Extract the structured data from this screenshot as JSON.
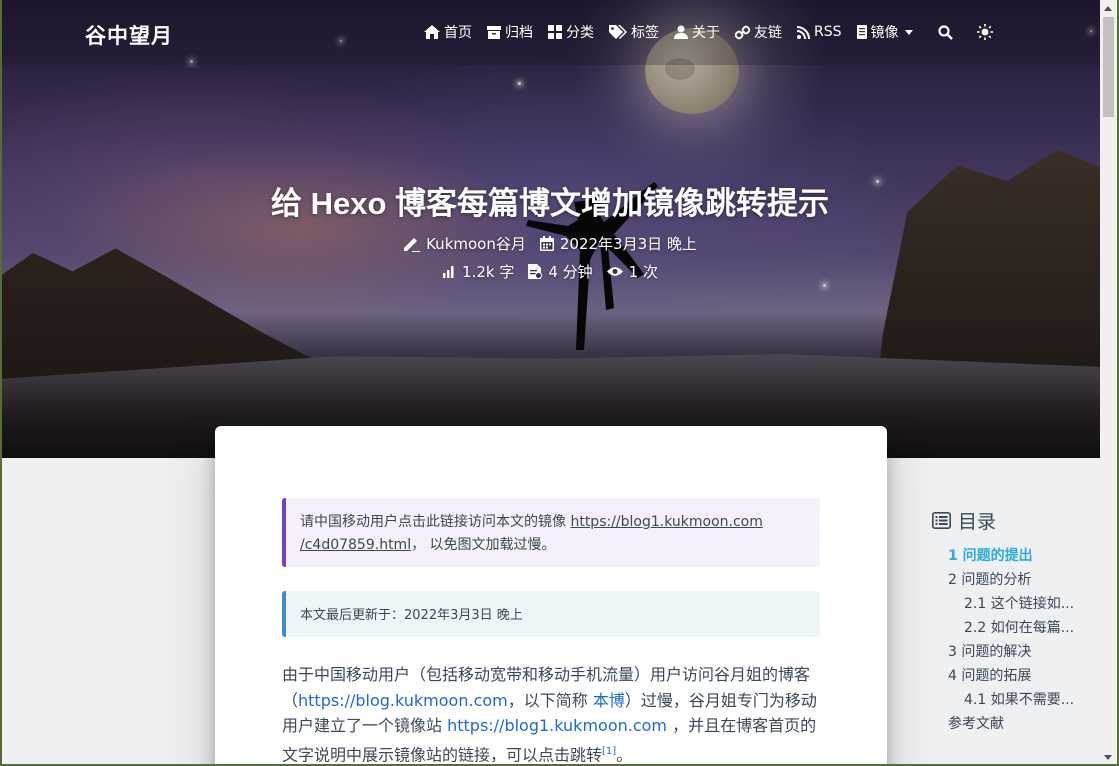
{
  "site": {
    "brand": "谷中望月"
  },
  "nav": {
    "items": [
      {
        "label": "首页",
        "icon": "home-icon"
      },
      {
        "label": "归档",
        "icon": "archive-icon"
      },
      {
        "label": "分类",
        "icon": "category-icon"
      },
      {
        "label": "标签",
        "icon": "tags-icon"
      },
      {
        "label": "关于",
        "icon": "user-icon"
      },
      {
        "label": "友链",
        "icon": "link-icon"
      },
      {
        "label": "RSS",
        "icon": "rss-icon"
      },
      {
        "label": "镜像",
        "icon": "mirror-icon",
        "dropdown": true
      }
    ],
    "search_icon": "search-icon",
    "theme_icon": "sun-icon"
  },
  "post": {
    "title": "给 Hexo 博客每篇博文增加镜像跳转提示",
    "author": "Kukmoon谷月",
    "date": "2022年3月3日 晚上",
    "words": "1.2k 字",
    "read_time": "4 分钟",
    "views": "1 次"
  },
  "content": {
    "mirror_note_prefix": "请中国移动用户点击此链接访问本文的镜像 ",
    "mirror_link_1": "https://blog1.kukmoon.com",
    "mirror_link_2": "/c4d07859.html",
    "mirror_note_suffix": "， 以免图文加载过慢。",
    "updated_note": "本文最后更新于：2022年3月3日 晚上",
    "para_1": "由于中国移动用户（包括移动宽带和移动手机流量）用户访问谷月姐的博客（",
    "para_link_blog": "https://blog.kukmoon.com",
    "para_2": "，以下简称 ",
    "para_link_self": "本博",
    "para_3": "）过慢，谷月姐专门为移动用户建立了一个镜像站 ",
    "para_link_mirror": "https://blog1.kukmoon.com",
    "para_4": " ，并且在博客首页的文字说明中展示镜像站的链接，可以点击跳转",
    "para_ref": "[1]",
    "para_5": "。"
  },
  "toc": {
    "title": "目录",
    "items": [
      {
        "label": "1 问题的提出",
        "level": 1,
        "active": true
      },
      {
        "label": "2 问题的分析",
        "level": 1
      },
      {
        "label": "2.1 这个链接如...",
        "level": 2
      },
      {
        "label": "2.2 如何在每篇...",
        "level": 2
      },
      {
        "label": "3 问题的解决",
        "level": 1
      },
      {
        "label": "4 问题的拓展",
        "level": 1
      },
      {
        "label": "4.1 如果不需要...",
        "level": 2
      },
      {
        "label": "参考文献",
        "level": 1
      }
    ]
  },
  "colors": {
    "accent": "#30a9de",
    "link": "#1e6ad1",
    "note_purple": "#6f42c1",
    "note_blue": "#428bca"
  }
}
